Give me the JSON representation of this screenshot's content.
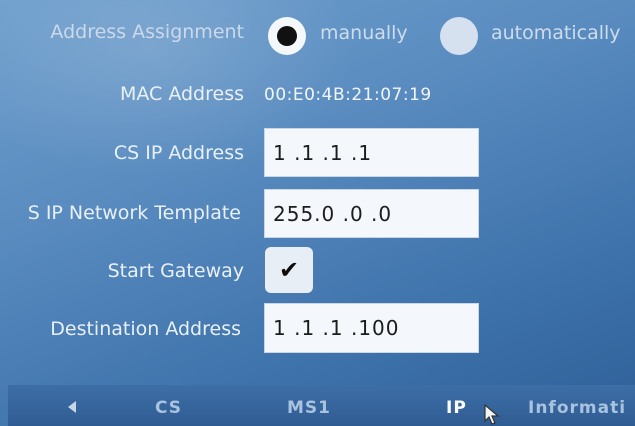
{
  "address_assignment": {
    "label": "Address Assignment",
    "options": [
      {
        "label": "manually",
        "selected": true
      },
      {
        "label": "automatically",
        "selected": false
      }
    ]
  },
  "mac_address": {
    "label": "MAC Address",
    "value": "00:E0:4B:21:07:19"
  },
  "cs_ip_address": {
    "label": "CS IP Address",
    "value": "1 .1 .1 .1"
  },
  "network_template": {
    "label": "S IP Network Template",
    "value": "255.0 .0 .0"
  },
  "start_gateway": {
    "label": "Start Gateway",
    "checked": true,
    "check_glyph": "✔"
  },
  "destination_address": {
    "label": "Destination Address",
    "value": "1 .1 .1 .100"
  },
  "tabs": [
    {
      "label": "CS",
      "active": false
    },
    {
      "label": "MS1",
      "active": false
    },
    {
      "label": "IP",
      "active": true
    },
    {
      "label": "Informati",
      "active": false
    }
  ],
  "icons": {
    "back": "left-arrow-icon",
    "cursor": "mouse-pointer-icon"
  },
  "colors": {
    "screen_bg": "#5a8cc0",
    "tabbar_bg": "#3a6aa2",
    "field_bg": "#f4f7fb"
  }
}
